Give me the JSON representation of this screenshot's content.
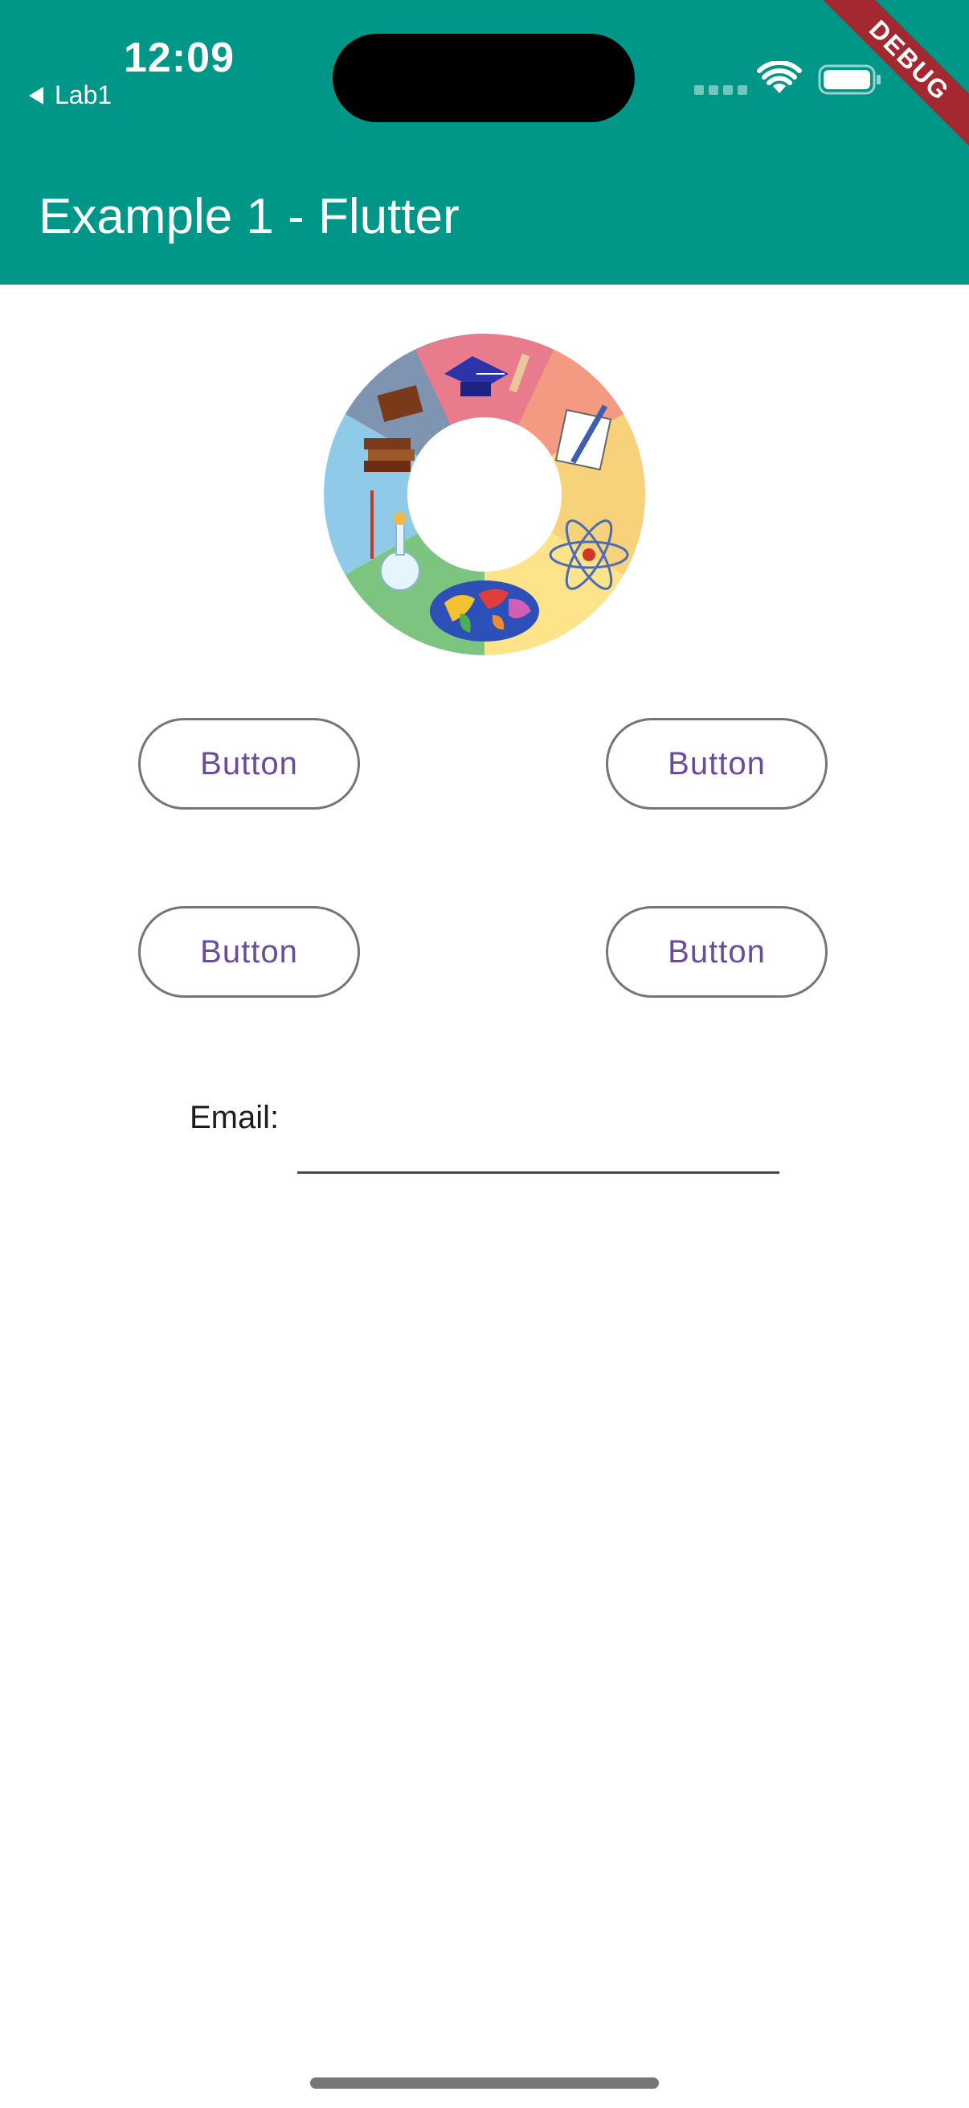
{
  "status_bar": {
    "time": "12:09",
    "back_app": "Lab1"
  },
  "debug_banner": "DEBUG",
  "app_bar": {
    "title": "Example 1 - Flutter"
  },
  "buttons": [
    {
      "label": "Button"
    },
    {
      "label": "Button"
    },
    {
      "label": "Button"
    },
    {
      "label": "Button"
    }
  ],
  "email": {
    "label": "Email:",
    "value": "",
    "placeholder": ""
  },
  "colors": {
    "app_bar": "#009688",
    "button_text": "#6a4c9c",
    "button_border": "#76737b",
    "debug_ribbon": "#a4282f"
  },
  "icons": [
    "back-arrow-icon",
    "wifi-icon",
    "battery-icon",
    "education-logo-icon"
  ]
}
